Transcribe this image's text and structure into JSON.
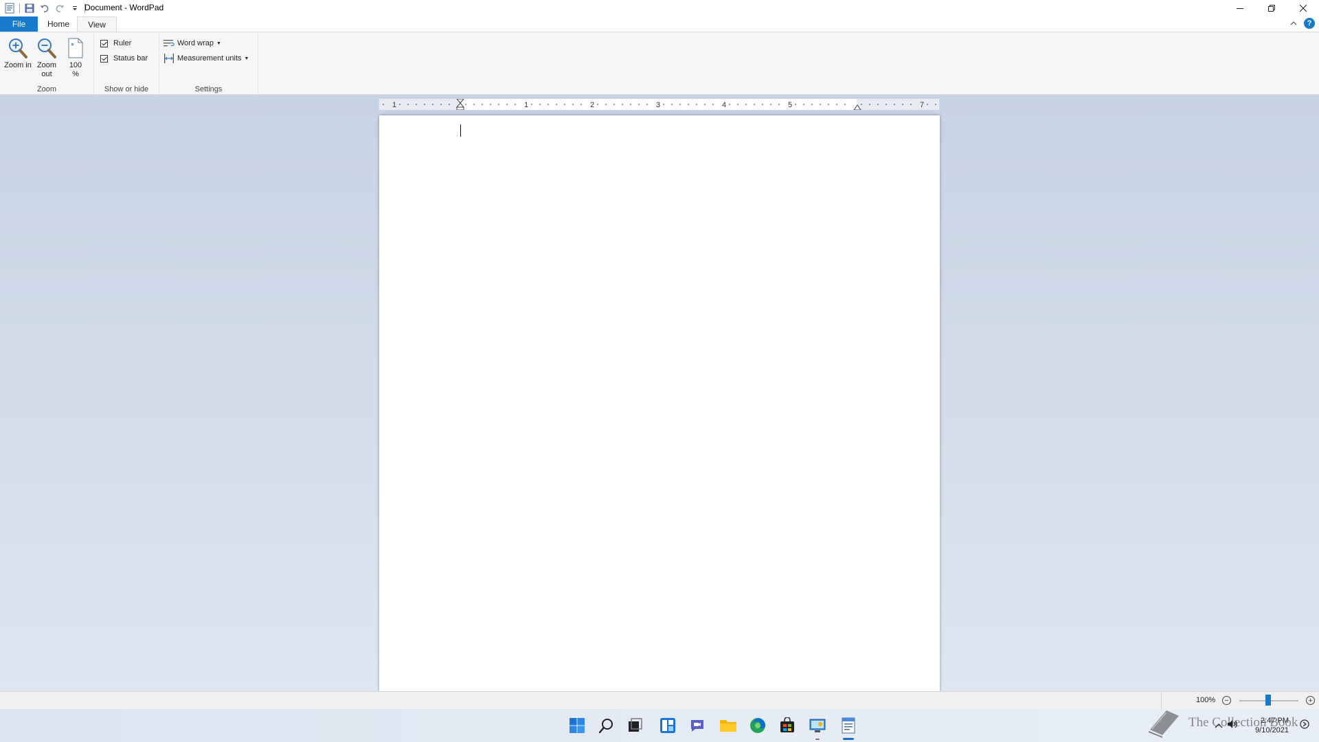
{
  "window": {
    "title": "Document - WordPad"
  },
  "tabs": [
    {
      "label": "File"
    },
    {
      "label": "Home"
    },
    {
      "label": "View"
    }
  ],
  "ribbon": {
    "zoom": {
      "label": "Zoom",
      "zoom_in": "Zoom in",
      "zoom_out": "Zoom out",
      "hundred": "100 %"
    },
    "show_hide": {
      "label": "Show or hide",
      "ruler": {
        "label": "Ruler",
        "checked": true
      },
      "status_bar": {
        "label": "Status bar",
        "checked": true
      }
    },
    "settings": {
      "label": "Settings",
      "word_wrap": "Word wrap",
      "measurement_units": "Measurement units"
    }
  },
  "ruler": {
    "numbers": [
      "1",
      "1",
      "2",
      "3",
      "4",
      "5",
      "7"
    ]
  },
  "statusbar": {
    "zoom_level": "100%",
    "zoom_value_percent": 100
  },
  "taskbar": {
    "icons": [
      "start-icon",
      "search-icon",
      "task-view-icon",
      "widgets-icon",
      "chat-icon",
      "file-explorer-icon",
      "edge-icon",
      "store-icon",
      "control-panel-icon",
      "wordpad-icon"
    ],
    "time": "2:47 PM",
    "date": "9/10/2021"
  },
  "watermark": {
    "text": "The Collection Book"
  },
  "colors": {
    "accent": "#1979ca",
    "ribbon_bg": "#f5f6f7",
    "workspace_top": "#c7d2e3",
    "workspace_bottom": "#dde6f1"
  }
}
